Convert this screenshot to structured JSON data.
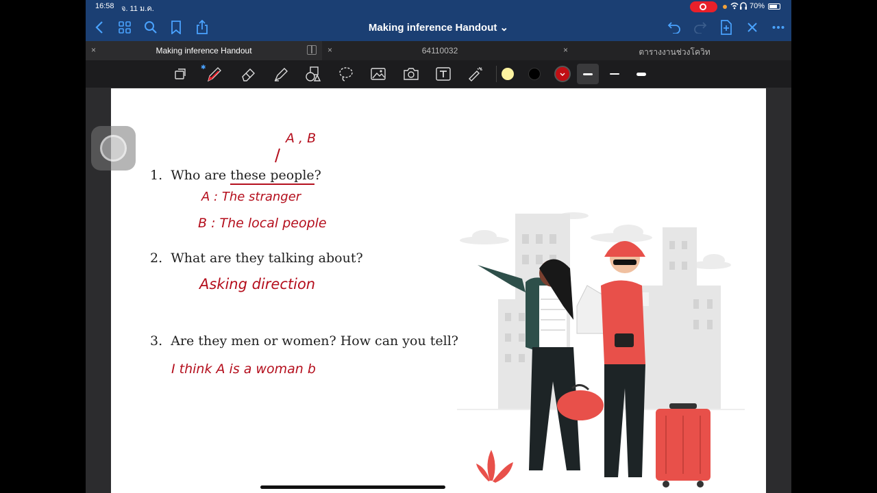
{
  "status": {
    "time": "16:58",
    "date": "จ. 11 ม.ค.",
    "battery": "70%"
  },
  "nav": {
    "title": "Making inference Handout ⌄"
  },
  "tabs": [
    {
      "label": "Making inference Handout",
      "active": true
    },
    {
      "label": "64110032",
      "active": false
    },
    {
      "label": "ตารางงานช่วงโควิท",
      "active": false
    }
  ],
  "toolbar": {
    "tools": [
      "lasso-scan",
      "pen",
      "eraser",
      "highlighter",
      "shapes",
      "lasso",
      "image",
      "camera",
      "text",
      "laser-pointer"
    ],
    "colors": [
      "#fdf3a0",
      "#000000",
      "#c00f14"
    ],
    "selected_color": "#c00f14"
  },
  "document": {
    "questions": [
      {
        "number": "1.",
        "pre": "Who are ",
        "underlined": "these people",
        "post": "?"
      },
      {
        "number": "2.",
        "text": "What are they talking about?"
      },
      {
        "number": "3.",
        "text": "Are they men or women? How can you tell?"
      }
    ],
    "handwriting": {
      "ab_note": "A , B",
      "a1": "A  :  The stranger",
      "b1": "B  :  The local people",
      "a2": "Asking direction",
      "a3": "I  think   A  is   a  woman   b"
    }
  }
}
